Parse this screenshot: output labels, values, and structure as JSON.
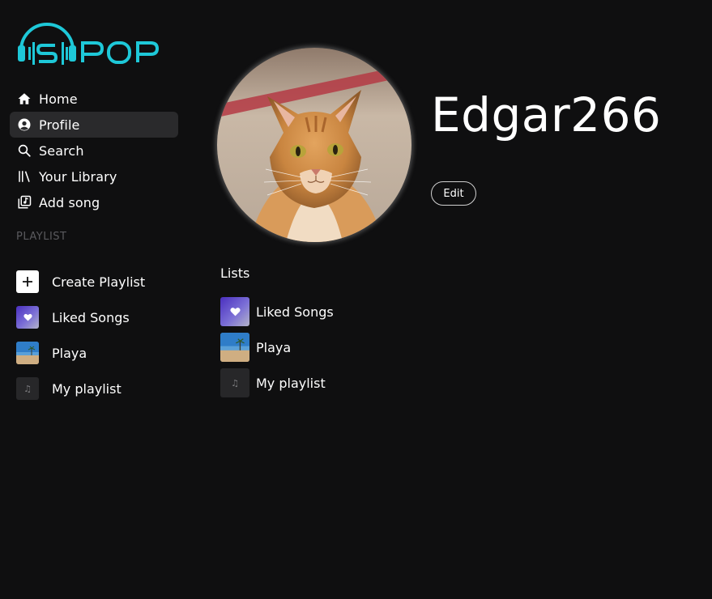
{
  "logo": {
    "text": "SPOP",
    "color": "#1ec8d8"
  },
  "nav": {
    "items": [
      {
        "label": "Home",
        "icon": "home-icon"
      },
      {
        "label": "Profile",
        "icon": "user-circle-icon",
        "active": true
      },
      {
        "label": "Search",
        "icon": "search-icon"
      },
      {
        "label": "Your Library",
        "icon": "library-icon"
      },
      {
        "label": "Add song",
        "icon": "add-song-icon"
      }
    ]
  },
  "sidebar_playlists": {
    "section_label": "PLAYLIST",
    "items": [
      {
        "label": "Create Playlist",
        "icon": "plus-icon"
      },
      {
        "label": "Liked Songs",
        "icon": "heart-icon"
      },
      {
        "label": "Playa",
        "icon": "beach-thumbnail"
      },
      {
        "label": "My playlist",
        "icon": "music-note-icon"
      }
    ]
  },
  "profile": {
    "username": "Edgar266",
    "edit_label": "Edit",
    "avatar": "orange-tabby-cat-photo"
  },
  "lists": {
    "title": "Lists",
    "items": [
      {
        "label": "Liked Songs",
        "icon": "heart-icon"
      },
      {
        "label": "Playa",
        "icon": "beach-thumbnail"
      },
      {
        "label": "My playlist",
        "icon": "music-note-icon"
      }
    ]
  },
  "colors": {
    "background": "#0f0f10",
    "active_nav": "#2a2a2c",
    "accent": "#1ec8d8",
    "muted_label": "#5a5a5e"
  }
}
